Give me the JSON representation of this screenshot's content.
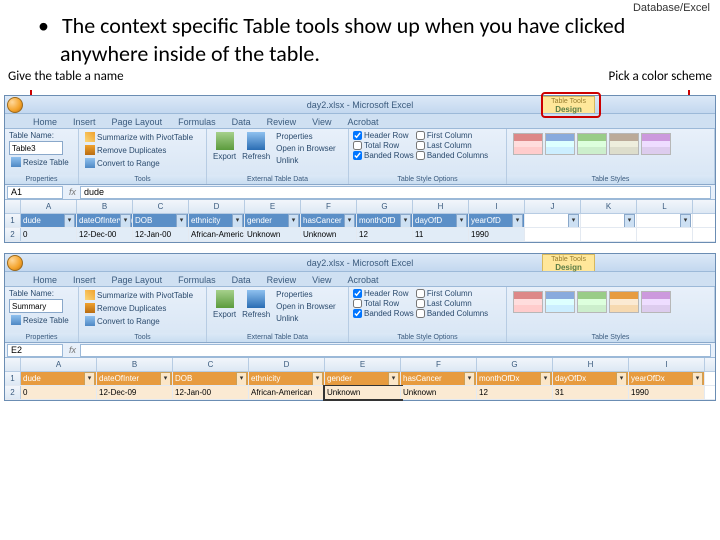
{
  "slide": {
    "topic": "Database/Excel",
    "bullet": "The context specific Table tools show up when you have clicked anywhere inside of the table.",
    "annot_left": "Give the table a name",
    "annot_right": "Pick a color scheme"
  },
  "top_window": {
    "title": "day2.xlsx - Microsoft Excel",
    "context_tab_top": "Table Tools",
    "context_tab_bottom": "Design",
    "tabs": {
      "home": "Home",
      "insert": "Insert",
      "layout": "Page Layout",
      "formulas": "Formulas",
      "data": "Data",
      "review": "Review",
      "view": "View",
      "acrobat": "Acrobat"
    },
    "table_name_label": "Table Name:",
    "table_name_value": "Table3",
    "resize": "Resize Table",
    "pivot": "Summarize with PivotTable",
    "remove_dupes": "Remove Duplicates",
    "convert": "Convert to Range",
    "export": "Export",
    "refresh": "Refresh",
    "ext_props": "Properties",
    "ext_open": "Open in Browser",
    "ext_unlink": "Unlink",
    "opt_header": "Header Row",
    "opt_total": "Total Row",
    "opt_banded_r": "Banded Rows",
    "opt_first": "First Column",
    "opt_last": "Last Column",
    "opt_banded_c": "Banded Columns",
    "grp_props": "Properties",
    "grp_tools": "Tools",
    "grp_ext": "External Table Data",
    "grp_opts": "Table Style Options",
    "grp_styles": "Table Styles",
    "namebox": "A1",
    "formula_val": "dude",
    "cols": [
      "A",
      "B",
      "C",
      "D",
      "E",
      "F",
      "G",
      "H",
      "I",
      "J",
      "K",
      "L"
    ],
    "headers": {
      "a": "dude",
      "b": "dateOfInterview",
      "c": "DOB",
      "d": "ethnicity",
      "e": "gender",
      "f": "hasCancer",
      "g": "monthOfD",
      "h": "dayOfD",
      "i": "yearOfD"
    },
    "data": {
      "a": "0",
      "b": "12-Dec-00",
      "c": "12-Jan-00",
      "d": "African-American",
      "e": "Unknown",
      "f": "Unknown",
      "g": "12",
      "h": "11",
      "i": "1990"
    }
  },
  "bottom_window": {
    "title": "day2.xlsx - Microsoft Excel",
    "context_tab_top": "Table Tools",
    "context_tab_bottom": "Design",
    "table_name_label": "Table Name:",
    "table_name_value": "Summary",
    "namebox": "E2",
    "cols": [
      "A",
      "B",
      "C",
      "D",
      "E",
      "F",
      "G",
      "H",
      "I"
    ],
    "headers": {
      "a": "dude",
      "b": "dateOfInter",
      "c": "DOB",
      "d": "ethnicity",
      "e": "gender",
      "f": "hasCancer",
      "g": "monthOfDx",
      "h": "dayOfDx",
      "i": "yearOfDx"
    },
    "data": {
      "a": "0",
      "b": "12-Dec-09",
      "c": "12-Jan-00",
      "d": "African-American",
      "e": "Unknown",
      "f": "Unknown",
      "g": "12",
      "h": "31",
      "i": "1990"
    }
  }
}
